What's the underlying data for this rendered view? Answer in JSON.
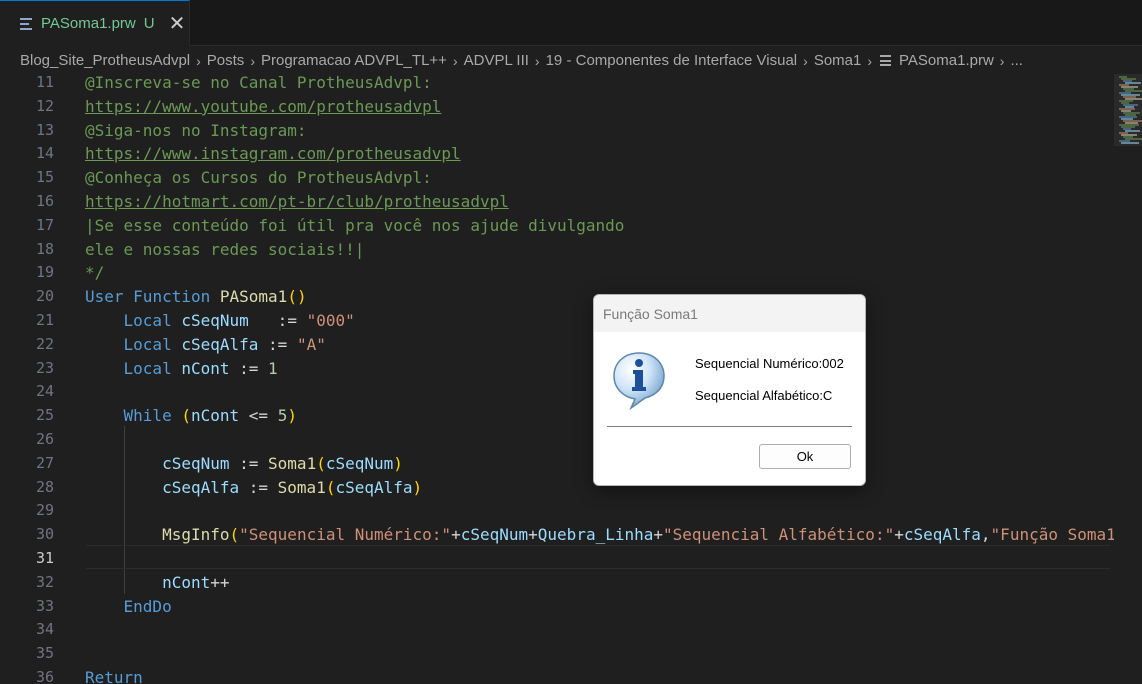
{
  "tab": {
    "title": "PASoma1.prw",
    "status": "U",
    "close": "✕"
  },
  "breadcrumb": {
    "items": [
      "Blog_Site_ProtheusAdvpl",
      "Posts",
      "Programacao ADVPL_TL++",
      "ADVPL III",
      "19 - Componentes de Interface Visual",
      "Soma1",
      "PASoma1.prw",
      "..."
    ],
    "separator": "›"
  },
  "editor": {
    "current_line": 31,
    "lines": [
      {
        "n": "11",
        "t": "@Inscreva-se no Canal ProtheusAdvpl:"
      },
      {
        "n": "12",
        "t": "https://www.youtube.com/protheusadvpl"
      },
      {
        "n": "13",
        "t": "@Siga-nos no Instagram:"
      },
      {
        "n": "14",
        "t": "https://www.instagram.com/protheusadvpl"
      },
      {
        "n": "15",
        "t": "@Conheça os Cursos do ProtheusAdvpl:"
      },
      {
        "n": "16",
        "t": "https://hotmart.com/pt-br/club/protheusadvpl"
      },
      {
        "n": "17",
        "t": "|Se esse conteúdo foi útil pra você nos ajude divulgando"
      },
      {
        "n": "18",
        "t": "ele e nossas redes sociais!!|"
      },
      {
        "n": "19",
        "t": "*/"
      },
      {
        "n": "20",
        "t": "User Function PASoma1()"
      },
      {
        "n": "21",
        "t": "    Local cSeqNum   := \"000\""
      },
      {
        "n": "22",
        "t": "    Local cSeqAlfa := \"A\""
      },
      {
        "n": "23",
        "t": "    Local nCont := 1"
      },
      {
        "n": "24",
        "t": ""
      },
      {
        "n": "25",
        "t": "    While (nCont <= 5)"
      },
      {
        "n": "26",
        "t": ""
      },
      {
        "n": "27",
        "t": "        cSeqNum := Soma1(cSeqNum)"
      },
      {
        "n": "28",
        "t": "        cSeqAlfa := Soma1(cSeqAlfa)"
      },
      {
        "n": "29",
        "t": ""
      },
      {
        "n": "30",
        "t": "        MsgInfo(\"Sequencial Numérico:\"+cSeqNum+Quebra_Linha+\"Sequencial Alfabético:\"+cSeqAlfa,\"Função Soma1"
      },
      {
        "n": "31",
        "t": ""
      },
      {
        "n": "32",
        "t": "        nCont++"
      },
      {
        "n": "33",
        "t": "    EndDo"
      },
      {
        "n": "34",
        "t": ""
      },
      {
        "n": "35",
        "t": ""
      },
      {
        "n": "36",
        "t": "Return"
      }
    ]
  },
  "dialog": {
    "title": "Função Soma1",
    "message_line1": "Sequencial Numérico:002",
    "message_line2": "Sequencial Alfabético:C",
    "ok_label": "Ok",
    "icon": "info-icon"
  },
  "colors": {
    "comment": "#6a9955",
    "keyword": "#569cd6",
    "function": "#dcdcaa",
    "variable": "#9cdcfe",
    "string": "#ce9178",
    "number": "#b5cea8",
    "bracket": "#ffd700",
    "bracket_inner": "#da70d6",
    "modified_tab": "#73c991",
    "editor_bg": "#1f1f1f"
  }
}
